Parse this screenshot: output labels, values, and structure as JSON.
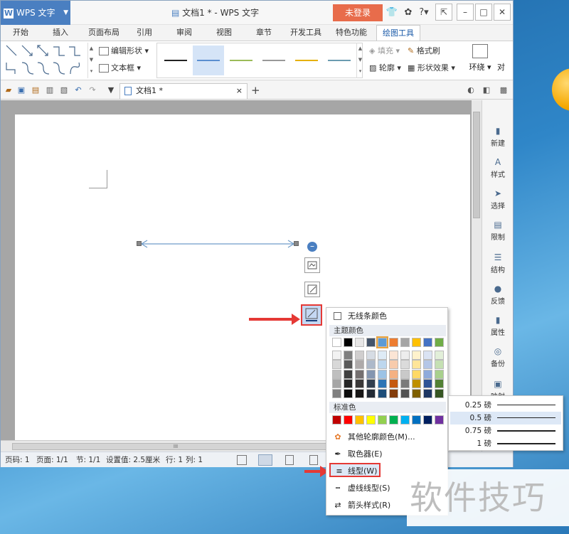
{
  "window": {
    "app_name": "WPS 文字",
    "logo_glyph": "W",
    "title": "文档1 * - WPS 文字",
    "login_label": "未登录"
  },
  "tabs": [
    "开始",
    "插入",
    "页面布局",
    "引用",
    "审阅",
    "视图",
    "章节",
    "开发工具",
    "特色功能",
    "绘图工具"
  ],
  "active_tab": "绘图工具",
  "ribbon": {
    "edit_shape": "编辑形状",
    "text_box": "文本框",
    "fill": "填充",
    "format_painter": "格式刷",
    "outline": "轮廓",
    "shape_effects": "形状效果",
    "wrap": "环绕",
    "align": "对",
    "line_style_colors": [
      "#222222",
      "#5b8fd0",
      "#9bbb59",
      "#999999",
      "#e6b000",
      "#6b9bb0"
    ],
    "selected_line_style": 1
  },
  "document_tab": {
    "name": "文档1 *",
    "close": "×",
    "new_tab": "+"
  },
  "side_panel": [
    "新建",
    "样式",
    "选择",
    "限制",
    "结构",
    "反馈",
    "属性",
    "备份",
    "映射"
  ],
  "status_bar": {
    "page_no": "页码: 1",
    "pages": "页面: 1/1",
    "section": "节: 1/1",
    "setting": "设置值: 2.5厘米",
    "row": "行: 1",
    "col": "列: 1"
  },
  "hscroll_grip": "III",
  "outline_menu": {
    "no_line_color": "无线条颜色",
    "theme_colors_header": "主题颜色",
    "theme_top_row": [
      "#ffffff",
      "#000000",
      "#e7e6e6",
      "#44546a",
      "#5b9bd5",
      "#ed7d31",
      "#a5a5a5",
      "#ffc000",
      "#4472c4",
      "#70ad47"
    ],
    "theme_shades": [
      [
        "#f2f2f2",
        "#7f7f7f",
        "#d0cece",
        "#d6dce4",
        "#deebf6",
        "#fbe5d5",
        "#ededed",
        "#fff2cc",
        "#dae3f3",
        "#e2efd9"
      ],
      [
        "#d8d8d8",
        "#595959",
        "#aeaaaa",
        "#adb9ca",
        "#bdd7ee",
        "#f7cbac",
        "#dbdbdb",
        "#fee599",
        "#b4c6e7",
        "#c5e0b3"
      ],
      [
        "#bfbfbf",
        "#3f3f3f",
        "#757070",
        "#8496b0",
        "#9cc3e5",
        "#f4b183",
        "#c9c9c9",
        "#ffd965",
        "#8eaadb",
        "#a8d08d"
      ],
      [
        "#a5a5a5",
        "#262626",
        "#3a3838",
        "#323f4f",
        "#2e75b5",
        "#c55a11",
        "#7b7b7b",
        "#bf9000",
        "#2f5496",
        "#538135"
      ],
      [
        "#7f7f7f",
        "#0c0c0c",
        "#171616",
        "#222a35",
        "#1e4e79",
        "#833c0b",
        "#525252",
        "#7f6000",
        "#1f3864",
        "#375623"
      ]
    ],
    "standard_header": "标准色",
    "standard_colors": [
      "#c00000",
      "#ff0000",
      "#ffc000",
      "#ffff00",
      "#92d050",
      "#00b050",
      "#00b0f0",
      "#0070c0",
      "#002060",
      "#7030a0"
    ],
    "more_colors": "其他轮廓颜色(M)...",
    "eyedropper": "取色器(E)",
    "line_type": "线型(W)",
    "dash_type": "虚线线型(S)",
    "arrow_style": "箭头样式(R)"
  },
  "line_weights": [
    "0.25 磅",
    "0.5 磅",
    "0.75 磅",
    "1 磅"
  ],
  "selected_weight": "0.5 磅",
  "watermark": "软件技巧"
}
